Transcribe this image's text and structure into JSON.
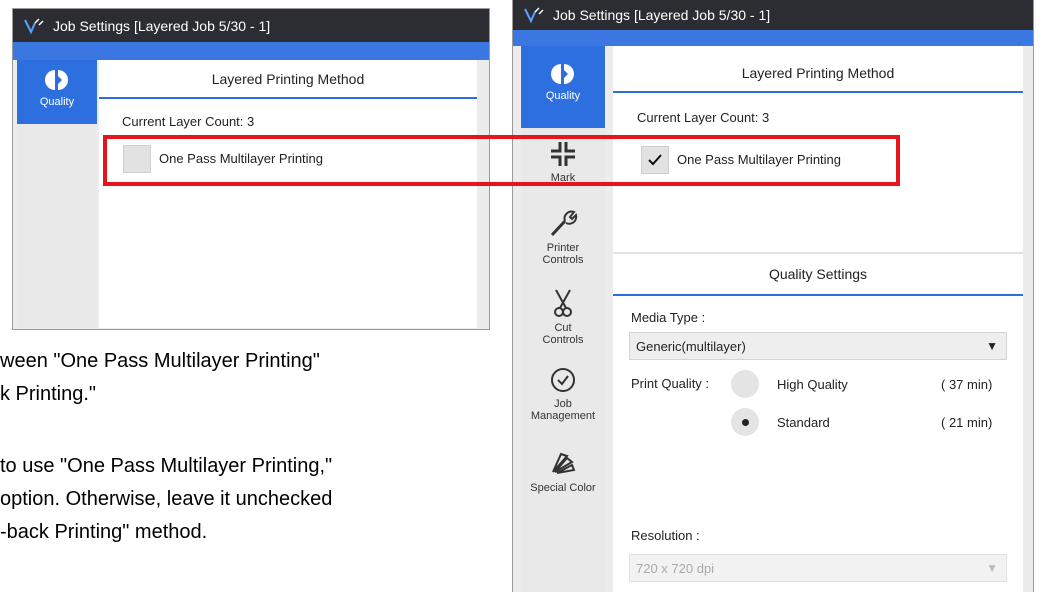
{
  "left_window": {
    "title": "Job Settings [Layered Job 5/30 - 1]",
    "sidebar": [
      {
        "label": "Quality",
        "icon": "quality-icon",
        "active": true
      }
    ],
    "section_title": "Layered Printing Method",
    "layer_count": "Current Layer Count: 3",
    "checkbox_label": "One Pass Multilayer Printing",
    "checked": false
  },
  "right_window": {
    "title": "Job Settings [Layered Job 5/30 - 1]",
    "sidebar": [
      {
        "label": "Quality",
        "icon": "quality-icon",
        "active": true
      },
      {
        "label": "Mark",
        "icon": "mark-icon"
      },
      {
        "label": "Printer Controls",
        "icon": "wrench-icon"
      },
      {
        "label": "Cut Controls",
        "icon": "scissors-icon"
      },
      {
        "label": "Job Management",
        "icon": "clock-icon"
      },
      {
        "label": "Special Color",
        "icon": "color-fan-icon"
      }
    ],
    "section_title": "Layered Printing Method",
    "layer_count": "Current Layer Count: 3",
    "checkbox_label": "One Pass Multilayer Printing",
    "checked": true,
    "quality_section_title": "Quality Settings",
    "media_type_label": "Media Type :",
    "media_type_value": "Generic(multilayer)",
    "print_quality_label": "Print Quality :",
    "quality_options": [
      {
        "label": "High Quality",
        "time": "( 37 min)",
        "selected": false
      },
      {
        "label": "Standard",
        "time": "( 21 min)",
        "selected": true
      }
    ],
    "resolution_label": "Resolution :",
    "resolution_value": "720 x 720 dpi"
  },
  "caption_lines": [
    "ween \"One Pass Multilayer Printing\"",
    "k Printing.\"",
    "to use \"One Pass Multilayer Printing,\"",
    "option. Otherwise, leave it unchecked",
    "-back Printing\" method."
  ],
  "colors": {
    "accent": "#2e6fe0",
    "highlight": "#e8141b",
    "titlebar": "#2b2d33"
  }
}
